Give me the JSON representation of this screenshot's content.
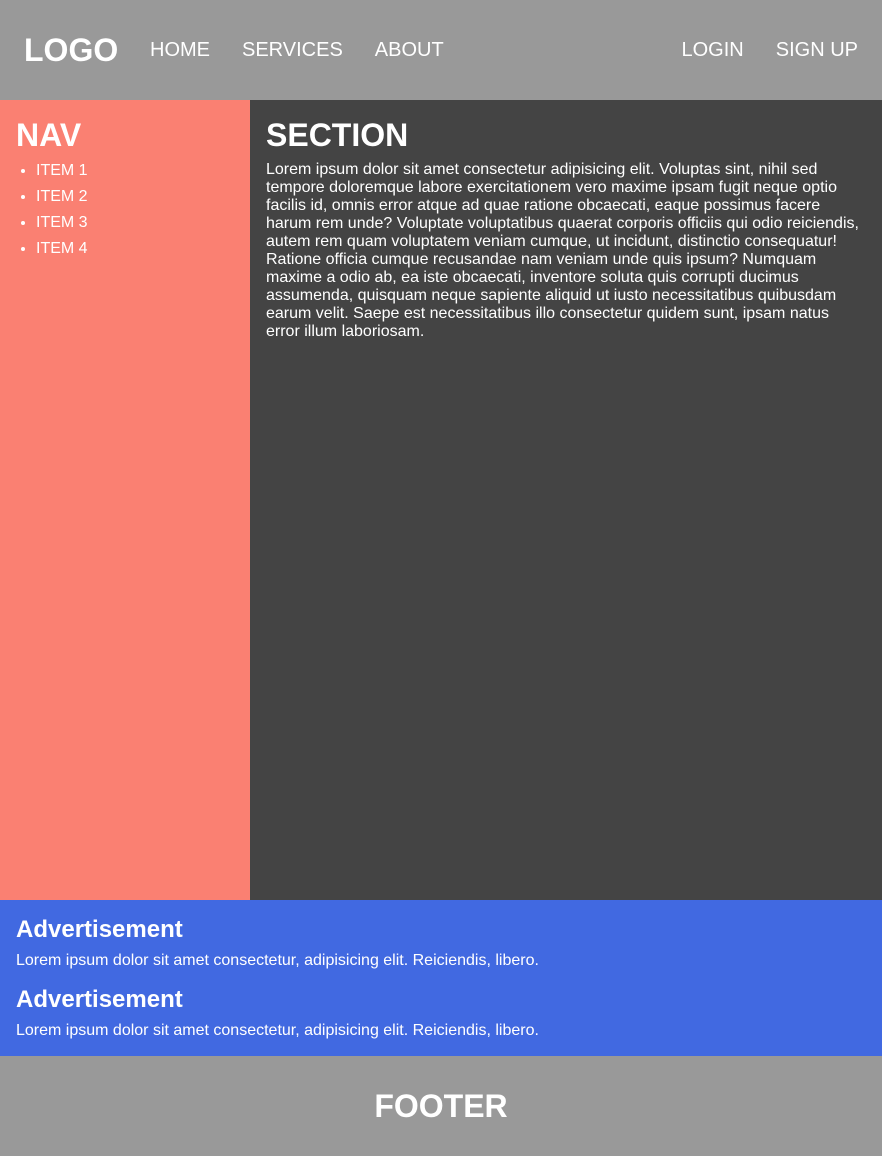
{
  "header": {
    "logo": "LOGO",
    "nav_left": [
      "HOME",
      "SERVICES",
      "ABOUT"
    ],
    "nav_right": [
      "LOGIN",
      "SIGN UP"
    ],
    "background": "#999999"
  },
  "sidebar": {
    "title": "NAV",
    "items": [
      "ITEM 1",
      "ITEM 2",
      "ITEM 3",
      "ITEM 4"
    ],
    "background": "#fa8072"
  },
  "section": {
    "title": "SECTION",
    "body": "Lorem ipsum dolor sit amet consectetur adipisicing elit. Voluptas sint, nihil sed tempore doloremque labore exercitationem vero maxime ipsam fugit neque optio facilis id, omnis error atque ad quae ratione obcaecati, eaque possimus facere harum rem unde? Voluptate voluptatibus quaerat corporis officiis qui odio reiciendis, autem rem quam voluptatem veniam cumque, ut incidunt, distinctio consequatur! Ratione officia cumque recusandae nam veniam unde quis ipsum? Numquam maxime a odio ab, ea iste obcaecati, inventore soluta quis corrupti ducimus assumenda, quisquam neque sapiente aliquid ut iusto necessitatibus quibusdam earum velit. Saepe est necessitatibus illo consectetur quidem sunt, ipsam natus error illum laboriosam.",
    "background": "#444444"
  },
  "ads": {
    "items": [
      {
        "title": "Advertisement",
        "text": "Lorem ipsum dolor sit amet consectetur, adipisicing elit. Reiciendis, libero."
      },
      {
        "title": "Advertisement",
        "text": "Lorem ipsum dolor sit amet consectetur, adipisicing elit. Reiciendis, libero."
      }
    ],
    "background": "#4169e1"
  },
  "footer": {
    "title": "FOOTER",
    "background": "#999999"
  }
}
